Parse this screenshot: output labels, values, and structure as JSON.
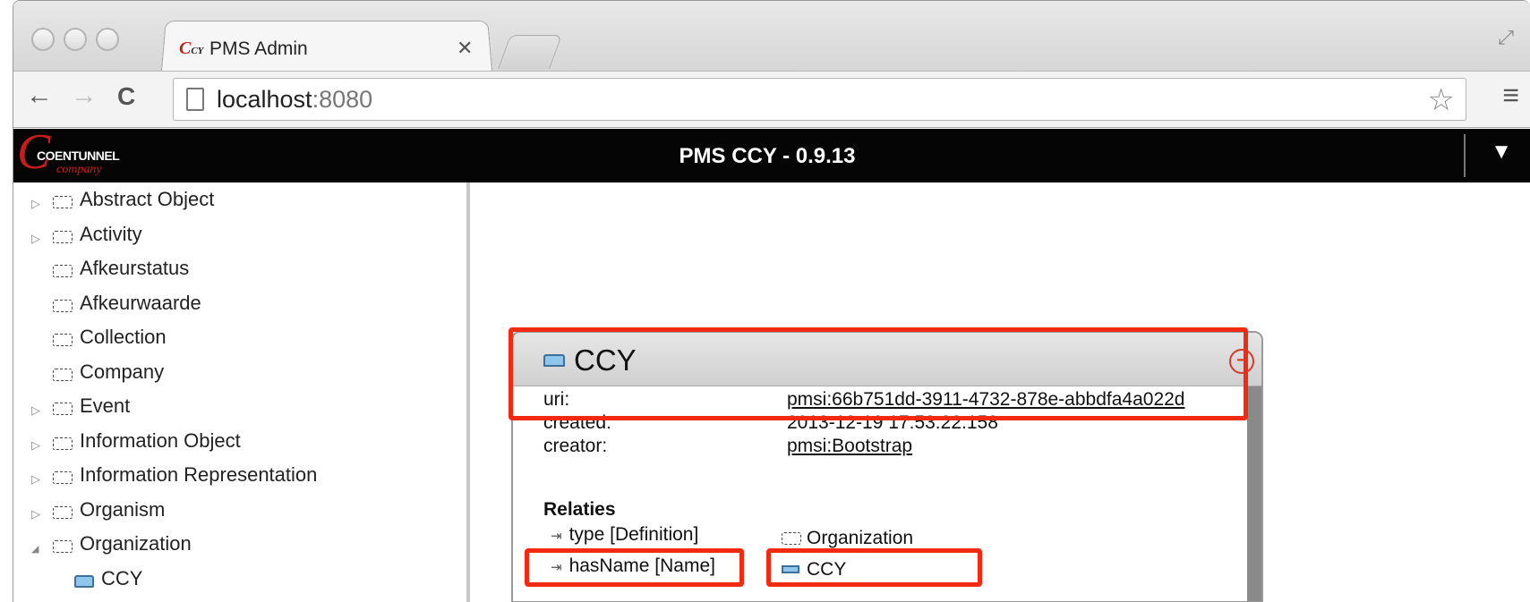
{
  "browser": {
    "tab_title": "PMS Admin",
    "tab_logo": "CY",
    "close_glyph": "✕",
    "url_host": "localhost",
    "url_port": ":8080",
    "back_glyph": "←",
    "forward_glyph": "→",
    "reload_glyph": "C",
    "star_glyph": "☆",
    "menu_glyph": "≡",
    "fullscreen_glyph": "⤢"
  },
  "app": {
    "brand_name": "COENTUNNEL",
    "brand_sub": "company",
    "brand_letter": "C",
    "title": "PMS CCY - 0.9.13",
    "dropdown_glyph": "▼"
  },
  "tree": [
    {
      "label": "Abstract Object",
      "expandable": true,
      "expanded": false
    },
    {
      "label": "Activity",
      "expandable": true,
      "expanded": false
    },
    {
      "label": "Afkeurstatus",
      "expandable": false
    },
    {
      "label": "Afkeurwaarde",
      "expandable": false
    },
    {
      "label": "Collection",
      "expandable": false
    },
    {
      "label": "Company",
      "expandable": false
    },
    {
      "label": "Event",
      "expandable": true,
      "expanded": false
    },
    {
      "label": "Information Object",
      "expandable": true,
      "expanded": false
    },
    {
      "label": "Information Representation",
      "expandable": true,
      "expanded": false
    },
    {
      "label": "Organism",
      "expandable": true,
      "expanded": false
    },
    {
      "label": "Organization",
      "expandable": true,
      "expanded": true
    },
    {
      "label": "CCY",
      "expandable": false,
      "instance": true
    }
  ],
  "tree_glyphs": {
    "collapsed": "▷",
    "expanded": "◢"
  },
  "panel": {
    "title": "CCY",
    "close_glyph": "−",
    "properties": {
      "uri_key": "uri:",
      "uri_value": "pmsi:66b751dd-3911-4732-878e-abbdfa4a022d",
      "created_key": "created:",
      "created_value": "2013-12-19 17:53:22.158",
      "creator_key": "creator:",
      "creator_value": "pmsi:Bootstrap"
    },
    "relations_title": "Relaties",
    "relations": [
      {
        "name": "type [Definition]",
        "target": "Organization"
      },
      {
        "name": "hasName [Name]",
        "target": "CCY"
      }
    ],
    "arrow_glyph": "⇥"
  },
  "colors": {
    "highlight": "#f22a12",
    "brand_red": "#cc1b1b",
    "instance_blue": "#8fc6ec"
  }
}
